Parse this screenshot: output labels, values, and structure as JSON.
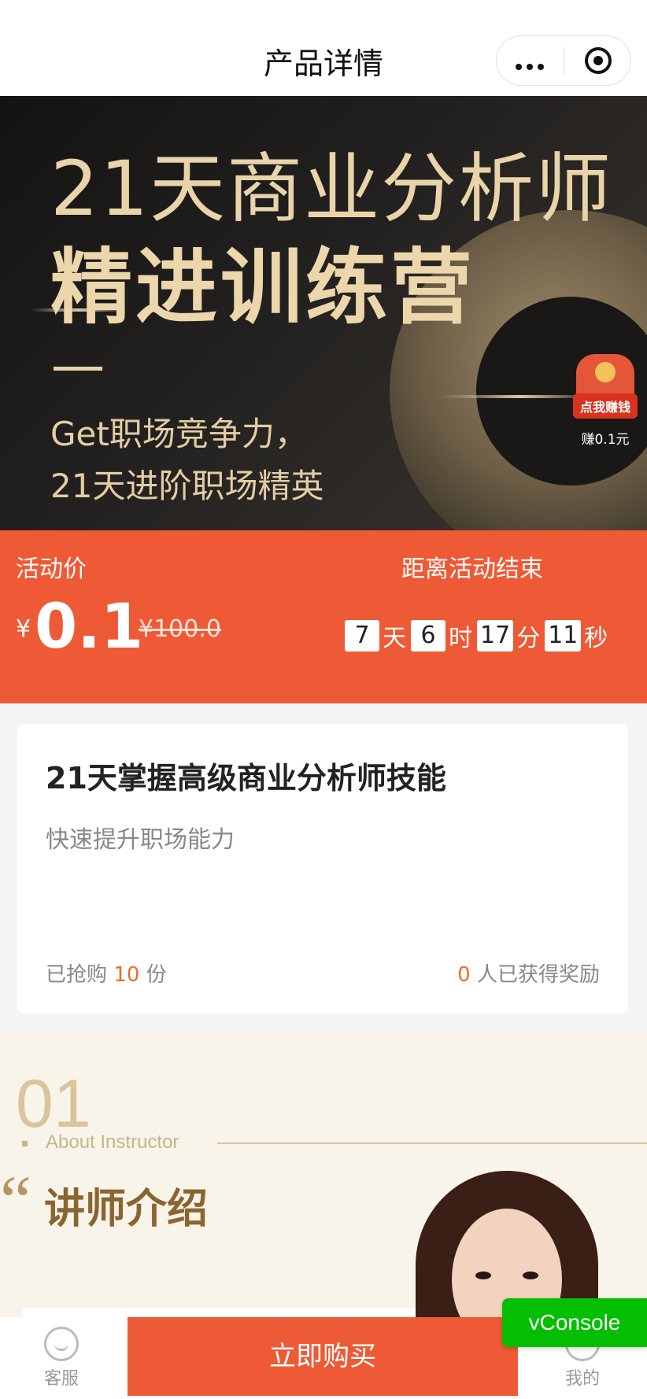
{
  "nav": {
    "title": "产品详情"
  },
  "banner": {
    "line1": "21天商业分析师",
    "line2": "精进训练营",
    "sub1": "Get职场竞争力，",
    "sub2": "21天进阶职场精英",
    "earn_tag": "点我赚钱",
    "earn_label": "赚0.1元"
  },
  "price": {
    "label": "活动价",
    "currency": "¥",
    "value": "0.1",
    "original": "¥100.0",
    "ends_label": "距离活动结束",
    "countdown": {
      "days": "7",
      "days_unit": "天",
      "hours": "6",
      "hours_unit": "时",
      "minutes": "17",
      "minutes_unit": "分",
      "seconds": "11",
      "seconds_unit": "秒"
    }
  },
  "product": {
    "title": "21天掌握高级商业分析师技能",
    "subtitle": "快速提升职场能力",
    "sold_prefix": "已抢购",
    "sold_count": "10",
    "sold_suffix": "份",
    "reward_count": "0",
    "reward_suffix": "人已获得奖励"
  },
  "intro": {
    "number": "01",
    "about": "About Instructor",
    "quote_mark": "“",
    "title": "讲师介绍"
  },
  "tabbar": {
    "service_label": "客服",
    "buy_label": "立即购买",
    "mine_label": "我的"
  },
  "vconsole": {
    "label": "vConsole"
  },
  "colors": {
    "accent": "#ee5a35",
    "highlight": "#f26b2a",
    "gold": "#e9d3a9",
    "vconsole": "#04be02"
  }
}
